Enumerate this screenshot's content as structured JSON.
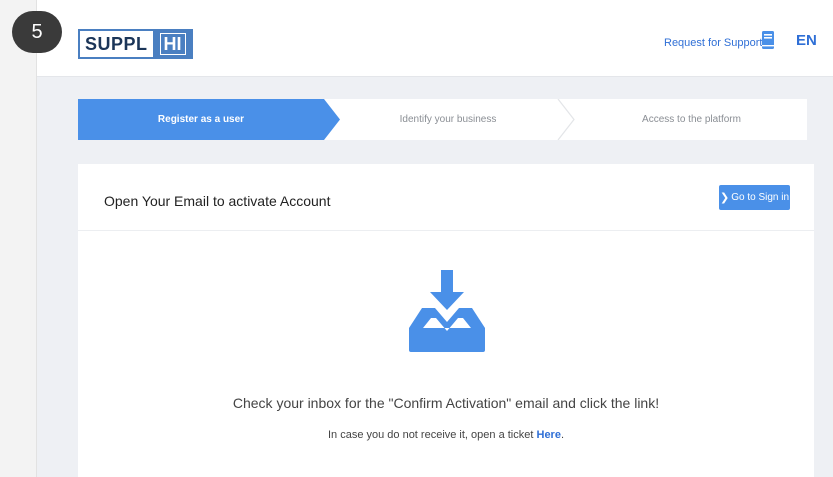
{
  "badge": {
    "number": "5"
  },
  "header": {
    "logo_left": "SUPPL",
    "logo_right": "HI",
    "support_link": "Request for Support",
    "book_icon": "book-icon",
    "language": "EN"
  },
  "stepper": {
    "steps": [
      {
        "label": "Register as a user",
        "active": true
      },
      {
        "label": "Identify your business",
        "active": false
      },
      {
        "label": "Access to the platform",
        "active": false
      }
    ]
  },
  "card": {
    "title": "Open Your Email to activate Account",
    "signin_label": "Go to Sign in",
    "message": "Check your inbox for the \"Confirm Activation\" email and click the link!",
    "sub_message_prefix": "In case you do not receive it, open a ticket",
    "sub_message_link": "Here",
    "sub_message_suffix": "."
  },
  "colors": {
    "accent": "#4a90e8",
    "link": "#2f6fd6",
    "background": "#eef0f4"
  }
}
